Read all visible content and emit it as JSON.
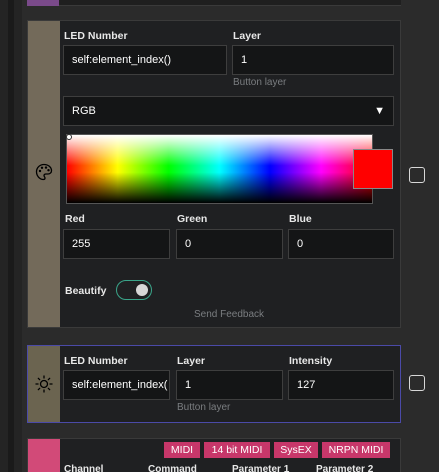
{
  "colors": {
    "background": "#2b2b2b",
    "card": "#1f2022",
    "led_card_side": "#736a5a",
    "light_card_side": "#6b6450",
    "light_card_border": "#4b4aa8",
    "midi_card_side": "#d24a78",
    "tag_bg": "#c7376a",
    "selected_color": "#ff0000",
    "toggle_border": "#3aa58a"
  },
  "led_card": {
    "icon": "palette-icon",
    "led_number_label": "LED Number",
    "led_number_value": "self:element_index()",
    "layer_label": "Layer",
    "layer_value": "1",
    "layer_hint": "Button layer",
    "mode_select": "RGB",
    "mode_caret": "▼",
    "red_label": "Red",
    "red_value": "255",
    "green_label": "Green",
    "green_value": "0",
    "blue_label": "Blue",
    "blue_value": "0",
    "beautify_label": "Beautify",
    "beautify_on": true,
    "send_feedback": "Send Feedback"
  },
  "intensity_card": {
    "icon": "sun-icon",
    "led_number_label": "LED Number",
    "led_number_value": "self:element_index(",
    "layer_label": "Layer",
    "layer_value": "1",
    "layer_hint": "Button layer",
    "intensity_label": "Intensity",
    "intensity_value": "127"
  },
  "midi_card": {
    "tags": [
      "MIDI",
      "14 bit MIDI",
      "SysEX",
      "NRPN MIDI"
    ],
    "columns": [
      "Channel",
      "Command",
      "Parameter 1",
      "Parameter 2"
    ]
  }
}
